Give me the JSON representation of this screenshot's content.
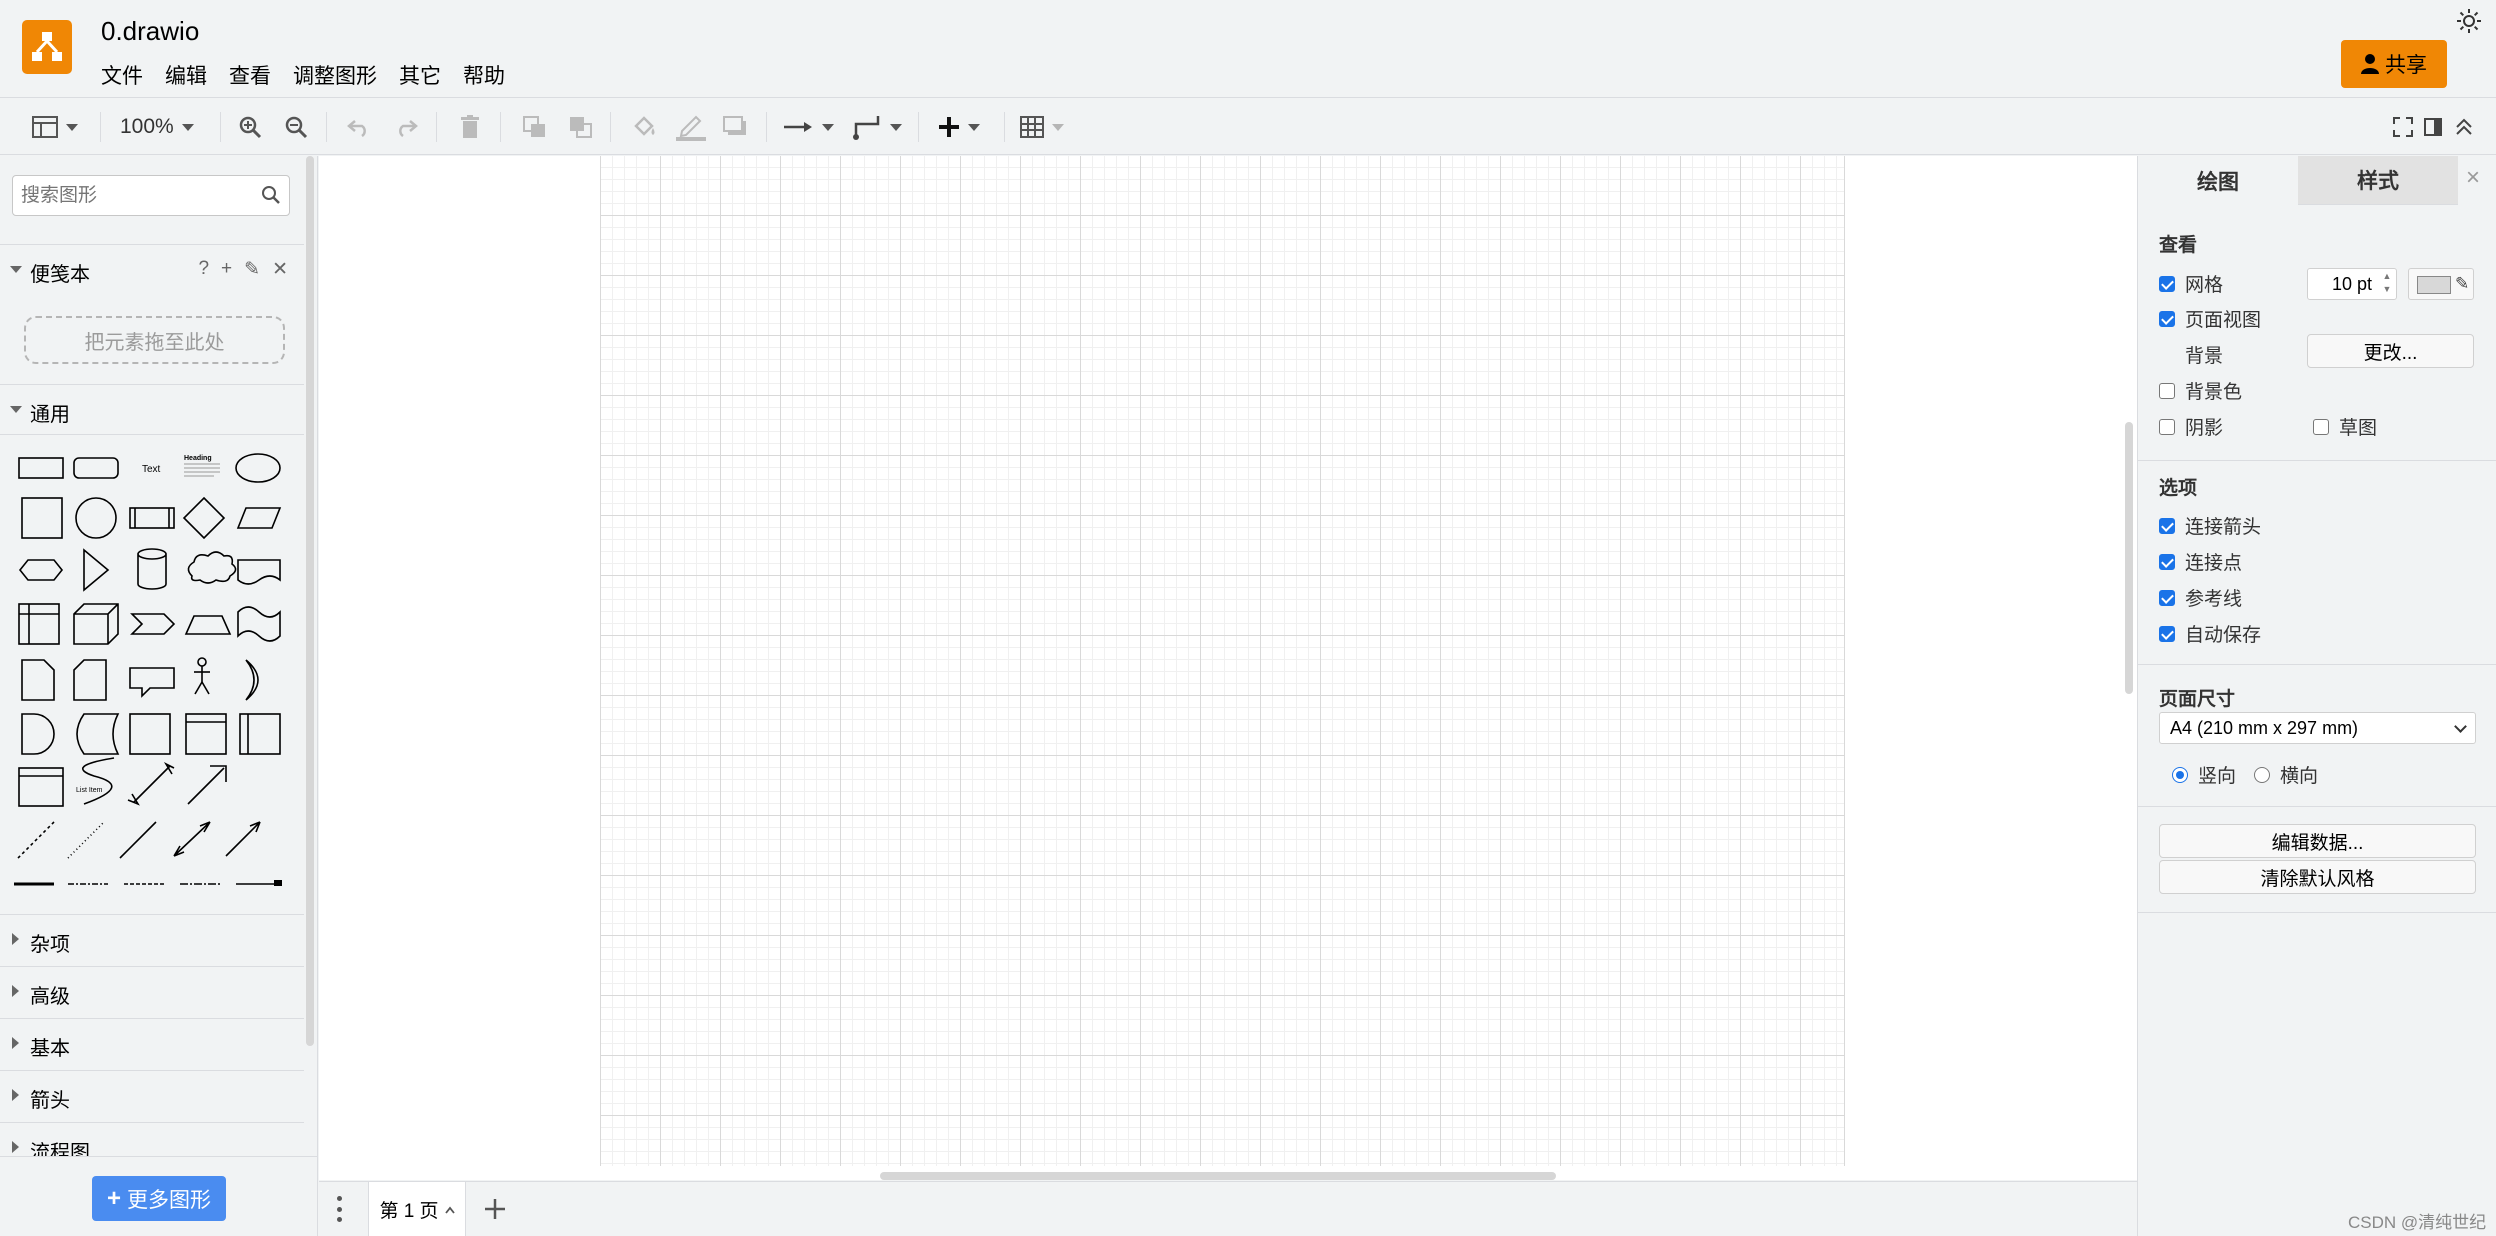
{
  "app": {
    "file_title": "0.drawio",
    "menu": [
      "文件",
      "编辑",
      "查看",
      "调整图形",
      "其它",
      "帮助"
    ],
    "share_label": "共享",
    "accent_color": "#f08705"
  },
  "toolbar": {
    "zoom": "100%",
    "icons": [
      "view-icon",
      "zoom-in-icon",
      "zoom-out-icon",
      "undo-icon",
      "redo-icon",
      "delete-icon",
      "to-front-icon",
      "to-back-icon",
      "fill-color-icon",
      "line-color-icon",
      "shadow-icon",
      "connection-icon",
      "waypoints-icon",
      "insert-icon",
      "table-icon",
      "fullscreen-icon",
      "format-panel-icon",
      "collapse-icon"
    ]
  },
  "sidebar": {
    "search_placeholder": "搜索图形",
    "scratchpad": {
      "title": "便笺本",
      "tools": [
        "?",
        "+",
        "✎",
        "✕"
      ],
      "drop_hint": "把元素拖至此处"
    },
    "general_title": "通用",
    "shape_text": {
      "text": "Text",
      "heading": "Heading",
      "list_item": "List Item"
    },
    "collapsed_sections": [
      "杂项",
      "高级",
      "基本",
      "箭头",
      "流程图"
    ],
    "more_shapes": "更多图形"
  },
  "pages": {
    "current": "第 1 页"
  },
  "format_panel": {
    "tabs": [
      "绘图",
      "样式"
    ],
    "view_section": {
      "title": "查看",
      "grid_label": "网格",
      "grid_checked": true,
      "grid_size": "10 pt",
      "page_view_label": "页面视图",
      "page_view_checked": true,
      "background_label": "背景",
      "change_button": "更改...",
      "background_color_label": "背景色",
      "background_color_checked": false,
      "shadow_label": "阴影",
      "shadow_checked": false,
      "sketch_label": "草图",
      "sketch_checked": false
    },
    "options_section": {
      "title": "选项",
      "items": [
        {
          "label": "连接箭头",
          "checked": true
        },
        {
          "label": "连接点",
          "checked": true
        },
        {
          "label": "参考线",
          "checked": true
        },
        {
          "label": "自动保存",
          "checked": true
        }
      ]
    },
    "page_size_section": {
      "title": "页面尺寸",
      "selected": "A4 (210 mm x 297 mm)",
      "portrait": "竖向",
      "landscape": "横向",
      "orientation": "portrait"
    },
    "edit_data_button": "编辑数据...",
    "clear_style_button": "清除默认风格"
  },
  "watermark": "CSDN @清纯世纪"
}
